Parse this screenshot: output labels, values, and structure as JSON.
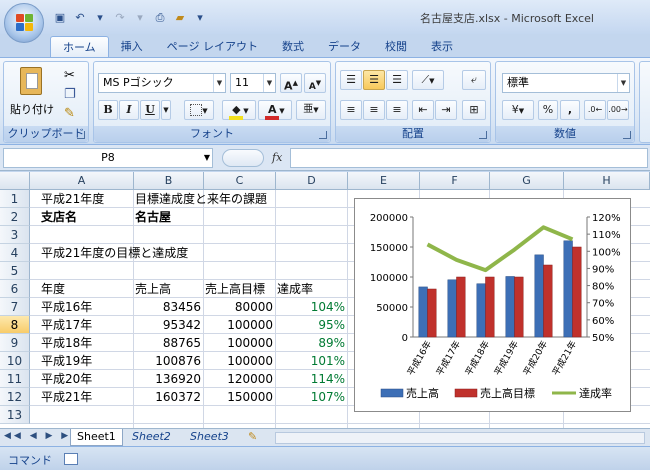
{
  "window": {
    "title": "名古屋支店.xlsx - Microsoft Excel"
  },
  "ribbon_tabs": [
    "ホーム",
    "挿入",
    "ページ レイアウト",
    "数式",
    "データ",
    "校閲",
    "表示"
  ],
  "ribbon": {
    "clipboard_group": "クリップボード",
    "paste_label": "貼り付け",
    "font_group": "フォント",
    "font_name": "MS Pゴシック",
    "font_size": "11",
    "bold": "B",
    "italic": "I",
    "underline": "U",
    "align_group": "配置",
    "number_group": "数値",
    "number_format": "標準",
    "percent": "%",
    "comma": ","
  },
  "formula_bar": {
    "name_box": "P8",
    "fx_label": "fx",
    "formula": ""
  },
  "columns": [
    "A",
    "B",
    "C",
    "D",
    "E",
    "F",
    "G",
    "H"
  ],
  "rows": [
    "1",
    "2",
    "3",
    "4",
    "5",
    "6",
    "7",
    "8",
    "9",
    "10",
    "11",
    "12",
    "13"
  ],
  "cells": {
    "a1": "平成21年度",
    "b1": "目標達成度と来年の課題",
    "a2": "支店名",
    "b2": "名古屋",
    "a4": "平成21年度の目標と達成度",
    "a6": "年度",
    "b6": "売上高",
    "c6": "売上高目標",
    "d6": "達成率",
    "data_rows": [
      {
        "year": "平成16年",
        "sales": "83456",
        "target": "80000",
        "rate": "104%"
      },
      {
        "year": "平成17年",
        "sales": "95342",
        "target": "100000",
        "rate": "95%"
      },
      {
        "year": "平成18年",
        "sales": "88765",
        "target": "100000",
        "rate": "89%"
      },
      {
        "year": "平成19年",
        "sales": "100876",
        "target": "100000",
        "rate": "101%"
      },
      {
        "year": "平成20年",
        "sales": "136920",
        "target": "120000",
        "rate": "114%"
      },
      {
        "year": "平成21年",
        "sales": "160372",
        "target": "150000",
        "rate": "107%"
      }
    ]
  },
  "sheet_tabs": [
    "Sheet1",
    "Sheet2",
    "Sheet3"
  ],
  "status_bar": {
    "mode": "コマンド"
  },
  "colors": {
    "bar_sales": "#3d6fb6",
    "bar_target": "#c0312c",
    "line_rate": "#8fb64a",
    "rate_text": "#007a33"
  },
  "chart_data": {
    "type": "bar",
    "categories": [
      "平成16年",
      "平成17年",
      "平成18年",
      "平成19年",
      "平成20年",
      "平成21年"
    ],
    "series": [
      {
        "name": "売上高",
        "type": "bar",
        "axis": "left",
        "values": [
          83456,
          95342,
          88765,
          100876,
          136920,
          160372
        ]
      },
      {
        "name": "売上高目標",
        "type": "bar",
        "axis": "left",
        "values": [
          80000,
          100000,
          100000,
          100000,
          120000,
          150000
        ]
      },
      {
        "name": "達成率",
        "type": "line",
        "axis": "right",
        "values": [
          104,
          95,
          89,
          101,
          114,
          107
        ]
      }
    ],
    "ylim": [
      0,
      200000
    ],
    "yticks": [
      "0",
      "50000",
      "100000",
      "150000",
      "200000"
    ],
    "y2lim": [
      50,
      120
    ],
    "y2ticks": [
      "50%",
      "60%",
      "70%",
      "80%",
      "90%",
      "100%",
      "110%",
      "120%"
    ],
    "legend_placement": "bottom",
    "grid": false
  }
}
